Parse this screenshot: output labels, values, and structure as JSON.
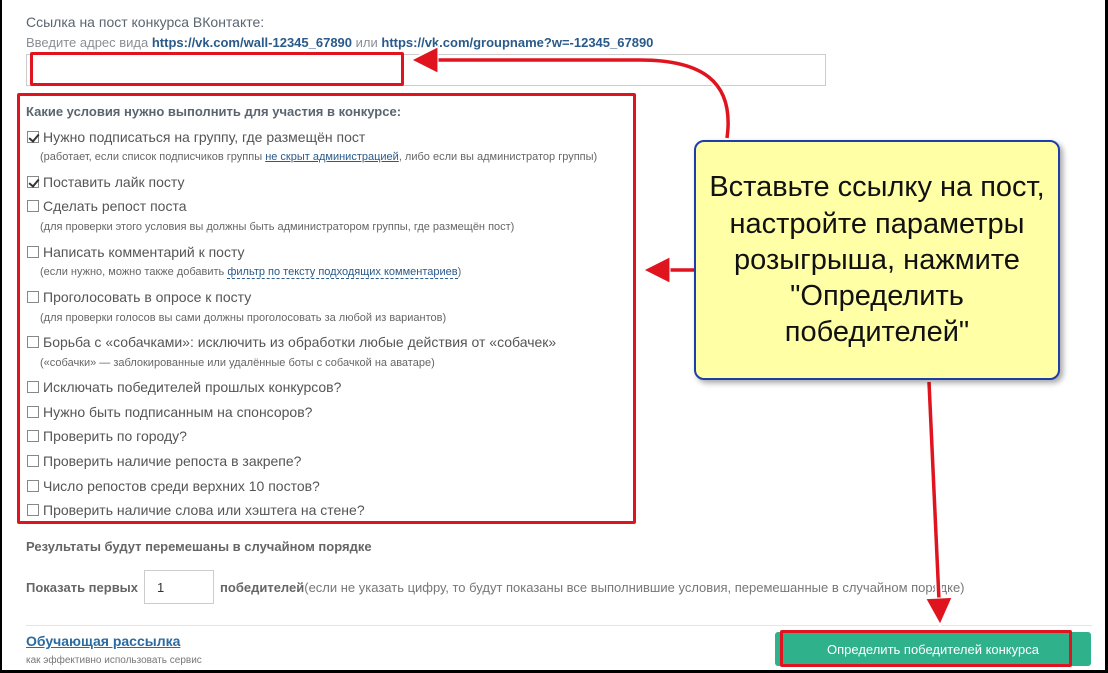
{
  "form": {
    "url_label": "Ссылка на пост конкурса ВКонтакте:",
    "url_hint_prefix": "Введите адрес вида ",
    "url_hint_example1": "https://vk.com/wall-12345_67890",
    "url_hint_or": " или ",
    "url_hint_example2": "https://vk.com/groupname?w=-12345_67890",
    "url_value": "",
    "conditions_title": "Какие условия нужно выполнить для участия в конкурсе:",
    "conditions": [
      {
        "label": "Нужно подписаться на группу, где размещён пост",
        "checked": true
      },
      {
        "label": "Поставить лайк посту",
        "checked": true
      },
      {
        "label": "Сделать репост поста",
        "checked": false
      },
      {
        "label": "Написать комментарий к посту",
        "checked": false
      },
      {
        "label": "Проголосовать в опросе к посту",
        "checked": false
      },
      {
        "label": "Борьба с «собачками»: исключить из обработки любые действия от «собачек»",
        "checked": false
      },
      {
        "label": "Исключать победителей прошлых конкурсов?",
        "checked": false
      },
      {
        "label": "Нужно быть подписанным на спонсоров?",
        "checked": false
      },
      {
        "label": "Проверить по городу?",
        "checked": false
      },
      {
        "label": "Проверить наличие репоста в закрепе?",
        "checked": false
      },
      {
        "label": "Число репостов среди верхних 10 постов?",
        "checked": false
      },
      {
        "label": "Проверить наличие слова или хэштега на стене?",
        "checked": false
      }
    ],
    "notes": {
      "n0_pre": "(работает, если список подписчиков группы ",
      "n0_link": "не скрыт администрацией",
      "n0_post": ", либо если вы администратор группы)",
      "n2": "(для проверки этого условия вы должны быть администратором группы, где размещён пост)",
      "n3_pre": "(если нужно, можно также добавить ",
      "n3_link": "фильтр по тексту подходящих комментариев",
      "n3_post": ")",
      "n4": "(для проверки голосов вы сами должны проголосовать за любой из вариантов)",
      "n5": "(«собачки» — заблокированные или удалённые боты с собачкой на аватаре)"
    },
    "results_note": "Результаты будут перемешаны в случайном порядке",
    "show_first_label": "Показать первых",
    "show_first_value": "1",
    "winners_label": "победителей",
    "winners_hint": " (если не указать цифру, то будут показаны все выполнившие условия, перемешанные в случайном порядке)",
    "mailing_link": "Обучающая рассылка",
    "mailing_sub": "как эффективно использовать сервис",
    "submit_label": "Определить победителей конкурса"
  },
  "callout": {
    "text": "Вставьте ссылку на пост, настройте параметры розыгрыша, нажмите \"Определить победителей\""
  },
  "colors": {
    "highlight_red": "#e0141e",
    "submit_green": "#2fb28c",
    "callout_bg": "#ffffa6",
    "callout_border": "#1d3faa",
    "link_blue": "#2a5a8a"
  }
}
